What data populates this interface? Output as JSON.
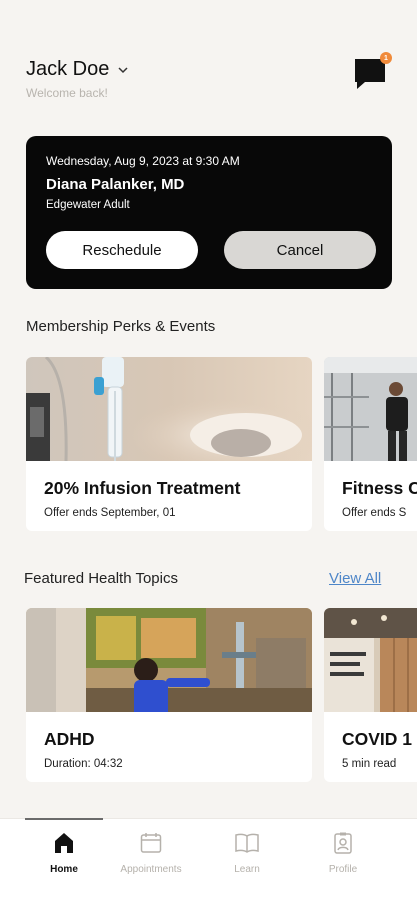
{
  "header": {
    "user_name": "Jack Doe",
    "welcome": "Welcome back!",
    "notification_count": "1"
  },
  "appointment": {
    "datetime": "Wednesday, Aug 9, 2023 at 9:30 AM",
    "doctor": "Diana Palanker, MD",
    "location": "Edgewater Adult",
    "reschedule_label": "Reschedule",
    "cancel_label": "Cancel"
  },
  "perks": {
    "title": "Membership Perks & Events",
    "cards": [
      {
        "title": "20% Infusion Treatment",
        "subtitle": "Offer ends September, 01"
      },
      {
        "title": "Fitness C",
        "subtitle": "Offer ends S"
      }
    ]
  },
  "topics": {
    "title": "Featured Health Topics",
    "view_all": "View All",
    "cards": [
      {
        "title": "ADHD",
        "subtitle": "Duration: 04:32"
      },
      {
        "title": "COVID 1",
        "subtitle": "5 min read"
      }
    ]
  },
  "nav": {
    "items": [
      {
        "label": "Home",
        "icon": "home-icon",
        "active": true
      },
      {
        "label": "Appointments",
        "icon": "calendar-icon",
        "active": false
      },
      {
        "label": "Learn",
        "icon": "book-icon",
        "active": false
      },
      {
        "label": "Profile",
        "icon": "profile-badge-icon",
        "active": false
      }
    ]
  },
  "colors": {
    "background": "#f6f4f1",
    "card_dark": "#080808",
    "accent_link": "#4e86c8",
    "badge": "#f08a3a"
  }
}
